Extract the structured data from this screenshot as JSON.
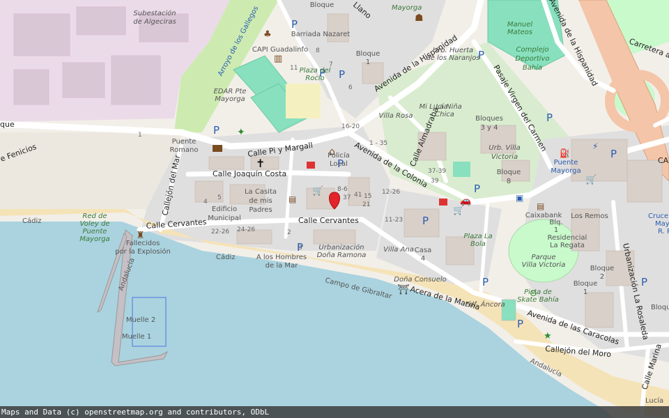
{
  "attribution": "Maps and Data (c) openstreetmap.org and contributors, ODbL",
  "colors": {
    "sea": "#aad3df",
    "beach": "#f5e3b8",
    "land": "#f2efe9",
    "residential": "#e0dfdf",
    "park": "#c8facc",
    "pitch": "#88e0be",
    "industrial": "#ebdbe8",
    "major_road": "#f4c5a8",
    "road": "#ffffff",
    "marker": "#e3242b"
  },
  "streets": {
    "avenida_hispanidad": "Avenida de la Hispanidad",
    "avenida_hispanidad_top": "Avenida de la Hispanidad",
    "calle_pi_margall": "Calle Pi y Margall",
    "calle_joaquin_costa": "Calle Joaquín Costa",
    "calle_cervantes_w": "Calle Cervantes",
    "calle_cervantes_e": "Calle Cervantes",
    "avenida_colonia": "Avenida de la Colonia",
    "calle_almadraba": "Calle Almadraba",
    "pasaje_virgen": "Pasaje Virgen del Carmen",
    "callejon_mar": "Callejón del Mar",
    "acera_marina": "Acera de la Marina",
    "avenida_caracolas": "Avenida de las Caracolas",
    "callejon_moro": "Callejón del Moro",
    "urbanizacion_rosaleda": "Urbanización La Rosaleda",
    "carretera": "Carretera al",
    "calle_marina": "Calle Marina",
    "fenicios": "e Fenicios",
    "que": "que",
    "llano": "Llano",
    "arroyo_gallegos": "Arroyo de los Gallegos",
    "campo_gibraltar": "Campo de Gibraltar",
    "cadiz_1": "Cádiz",
    "cadiz_2": "Cádiz",
    "andalucia_1": "Andalucía",
    "andalucia_2": "Andalucía",
    "ca": "CA"
  },
  "places": {
    "subestacion": [
      "Subestación",
      "de Algeciras"
    ],
    "barriada": "Barriada Nazaret",
    "capi": "CAPI Guadalinfo",
    "mayorga": "Mayorga",
    "plaza_rocio": [
      "Plaza del",
      "Rocío"
    ],
    "edar": [
      "EDAR Pte",
      "Mayorga"
    ],
    "puente_romano": [
      "Puente",
      "Romano"
    ],
    "policia": [
      "Policía",
      "Local"
    ],
    "casita": [
      "La Casita",
      "de mis",
      "Padres"
    ],
    "edificio": [
      "Edificio",
      "Municipal"
    ],
    "red_voley": [
      "Red de",
      "Voley de",
      "Puente",
      "Mayorga"
    ],
    "fallecidos": [
      "Fallecidos",
      "por la Explosión"
    ],
    "hombres_mar": [
      "A los Hombres",
      "de la Mar"
    ],
    "urb_dona_ramona": [
      "Urbanización",
      "Doña Ramona"
    ],
    "villa_ana": "Villa Ana",
    "casa_4": [
      "Casa",
      "4"
    ],
    "dona_consuelo": "Doña Consuelo",
    "edf_ancora": "Edf. Áncora",
    "villa_rosa": "Villa Rosa",
    "mi_lucia": [
      "Mi Lucía",
      "La Niña",
      "Chica"
    ],
    "urb_huerta": [
      "Urb. Huerta",
      "de los Naranjos"
    ],
    "manuel_mateos": [
      "Manuel",
      "Mateos"
    ],
    "complejo": [
      "Complejo",
      "Deportivo",
      "Bahía"
    ],
    "bloques_34": [
      "Bloques",
      "3 y 4"
    ],
    "urb_villa_victoria": [
      "Urb. Villa",
      "Victoria"
    ],
    "bloque_8": [
      "Bloque",
      "8"
    ],
    "puente_mayorga": [
      "Puente",
      "Mayorga"
    ],
    "caixabank": "Caixabank",
    "los_remos": "Los Remos",
    "residencial": [
      "Blq.",
      "1",
      "Residencial",
      "La Regata"
    ],
    "parque_villa": [
      "Parque",
      "Villa Victoria"
    ],
    "pista_skate": [
      "Pista de",
      "Skate Bahía"
    ],
    "plaza_bola": [
      "Plaza La",
      "Bola"
    ],
    "bloque_2": [
      "Bloque",
      "2"
    ],
    "bloque_1": [
      "Bloque",
      "1"
    ],
    "bloque_top": "Bloque",
    "bloque_1_top": [
      "Bloque",
      "1"
    ],
    "muelle_2": "Muelle 2",
    "muelle_1": "Muelle 1",
    "cruce": [
      "Cruce",
      "Mayo",
      "R. P"
    ],
    "lucia": "Lucía",
    "bloque_right": "Bloque"
  },
  "house_numbers": {
    "n11": "11",
    "n8": "8",
    "n7": "7",
    "n6": "6",
    "n1620": "16-20",
    "n135": "1 - 35",
    "n3739": "37-39",
    "n39": "39",
    "n1226": "12-26",
    "n86": "8-6",
    "n37": "37",
    "n41": "41",
    "n15": "15",
    "n21": "21",
    "n1123": "11-23",
    "n2226": "22-26",
    "n2426": "24-26",
    "n2": "2",
    "n3": "3",
    "n4": "4",
    "n5": "5",
    "n1": "1"
  },
  "marker": {
    "name": "selected-location"
  }
}
